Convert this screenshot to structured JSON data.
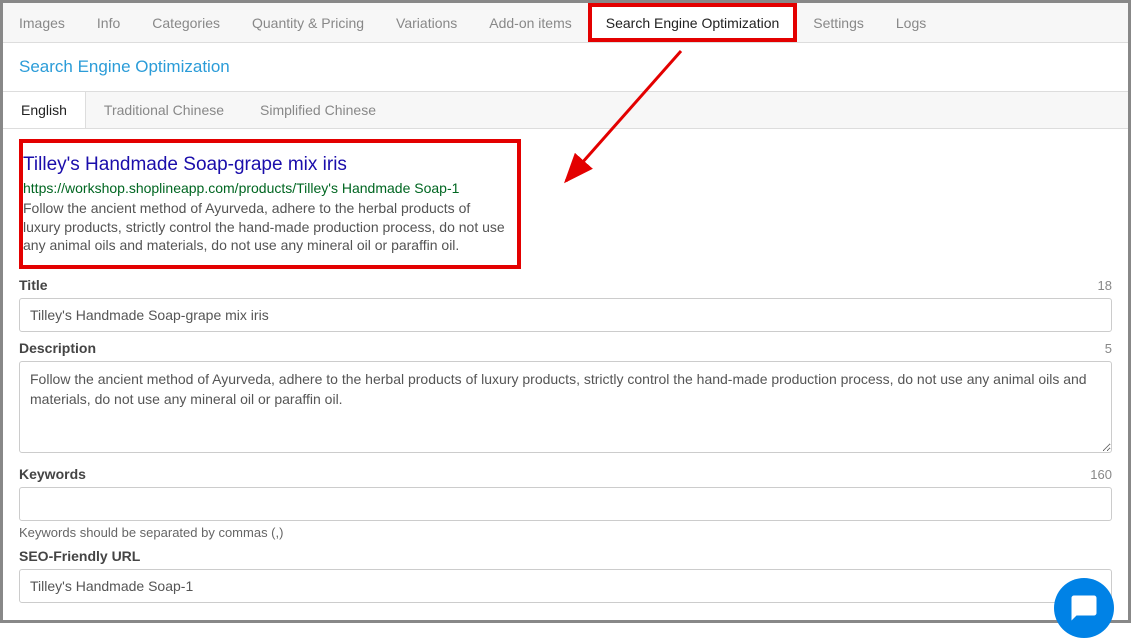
{
  "topTabs": [
    {
      "label": "Images"
    },
    {
      "label": "Info"
    },
    {
      "label": "Categories"
    },
    {
      "label": "Quantity & Pricing"
    },
    {
      "label": "Variations"
    },
    {
      "label": "Add-on items"
    },
    {
      "label": "Search Engine Optimization",
      "highlighted": true
    },
    {
      "label": "Settings"
    },
    {
      "label": "Logs"
    }
  ],
  "sectionTitle": "Search Engine Optimization",
  "langTabs": [
    {
      "label": "English",
      "active": true
    },
    {
      "label": "Traditional Chinese"
    },
    {
      "label": "Simplified Chinese"
    }
  ],
  "preview": {
    "title": "Tilley's Handmade Soap-grape mix iris",
    "url": "https://workshop.shoplineapp.com/products/Tilley's Handmade Soap-1",
    "description": "Follow the ancient method of Ayurveda, adhere to the herbal products of luxury products, strictly control the hand-made production process, do not use any animal oils and materials, do not use any mineral oil or paraffin oil."
  },
  "fields": {
    "title": {
      "label": "Title",
      "value": "Tilley's Handmade Soap-grape mix iris",
      "counter": "18"
    },
    "description": {
      "label": "Description",
      "value": "Follow the ancient method of Ayurveda, adhere to the herbal products of luxury products, strictly control the hand-made production process, do not use any animal oils and materials, do not use any mineral oil or paraffin oil.",
      "counter": "5"
    },
    "keywords": {
      "label": "Keywords",
      "value": "",
      "counter": "160",
      "hint": "Keywords should be separated by commas (,)"
    },
    "seoUrl": {
      "label": "SEO-Friendly URL",
      "value": "Tilley's Handmade Soap-1"
    }
  }
}
